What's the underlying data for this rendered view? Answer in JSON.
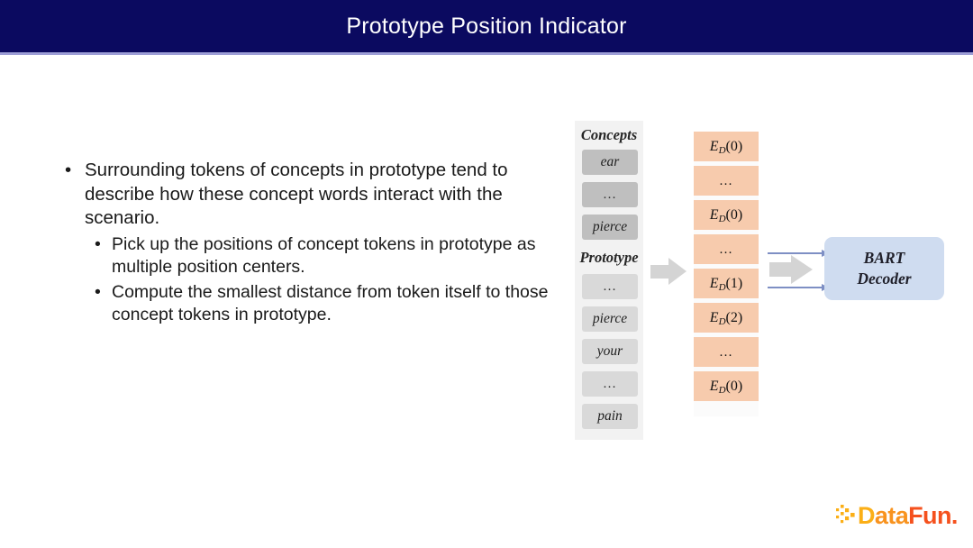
{
  "title": {
    "text": "Prototype Position Indicator",
    "bar_color": "#0b0a60",
    "underline_color": "#9d9ed6",
    "text_color": "#ffffff"
  },
  "bullets": [
    {
      "level": 1,
      "marker": "•",
      "text": "Surrounding tokens of concepts in prototype tend to describe how these concept words interact with the scenario."
    },
    {
      "level": 2,
      "marker": "•",
      "text": "Pick up the positions of concept tokens in prototype as multiple position centers."
    },
    {
      "level": 2,
      "marker": "•",
      "text": "Compute the smallest distance from token itself to those concept tokens in prototype."
    }
  ],
  "diagram": {
    "concepts": {
      "heading": "Concepts",
      "box_color": "#bfbfbf",
      "tokens": [
        "ear",
        "…",
        "pierce"
      ]
    },
    "prototype": {
      "heading": "Prototype",
      "box_color": "#d9d9d9",
      "tokens": [
        "…",
        "pierce",
        "your",
        "…",
        "pain"
      ]
    },
    "embeddings": {
      "box_color": "#f7cbad",
      "items": [
        {
          "kind": "formula",
          "base": "E",
          "sub": "D",
          "arg": "0"
        },
        {
          "kind": "ellipsis",
          "text": "…"
        },
        {
          "kind": "formula",
          "base": "E",
          "sub": "D",
          "arg": "0"
        },
        {
          "kind": "ellipsis",
          "text": "…"
        },
        {
          "kind": "formula",
          "base": "E",
          "sub": "D",
          "arg": "1"
        },
        {
          "kind": "formula",
          "base": "E",
          "sub": "D",
          "arg": "2"
        },
        {
          "kind": "ellipsis",
          "text": "…"
        },
        {
          "kind": "formula",
          "base": "E",
          "sub": "D",
          "arg": "0"
        }
      ]
    },
    "decoder": {
      "line1": "BART",
      "line2": "Decoder",
      "box_color": "#cfdcf0"
    },
    "arrows": {
      "block_color": "#d4d4d4",
      "thin_color": "#7e8fc4"
    }
  },
  "logo": {
    "word_parts": [
      "D",
      "ata",
      "F",
      "un."
    ],
    "colors": [
      "#fbaf17",
      "#f8931f",
      "#f5511e",
      "#f5511e"
    ],
    "dot_color": "#fbaf17"
  }
}
